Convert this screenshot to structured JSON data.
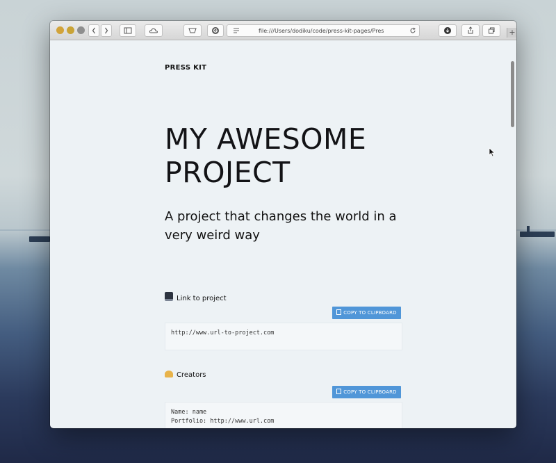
{
  "browser": {
    "url": "file:///Users/dodiku/code/press-kit-pages/Pres"
  },
  "page": {
    "brand": "PRESS KIT",
    "headline": "MY AWESOME PROJECT",
    "tagline": "A project that changes the world in a very weird way",
    "sections": [
      {
        "label": "Link to project",
        "icon": "desktop-computer-emoji",
        "copy_label": "COPY TO CLIPBOARD",
        "lines": [
          "http://www.url-to-project.com"
        ]
      },
      {
        "label": "Creators",
        "icon": "construction-worker-emoji",
        "copy_label": "COPY TO CLIPBOARD",
        "lines": [
          "Name: name",
          "Portfolio: http://www.url.com"
        ]
      }
    ]
  },
  "colors": {
    "accent": "#5096d8",
    "page_background": "#edf2f5"
  }
}
